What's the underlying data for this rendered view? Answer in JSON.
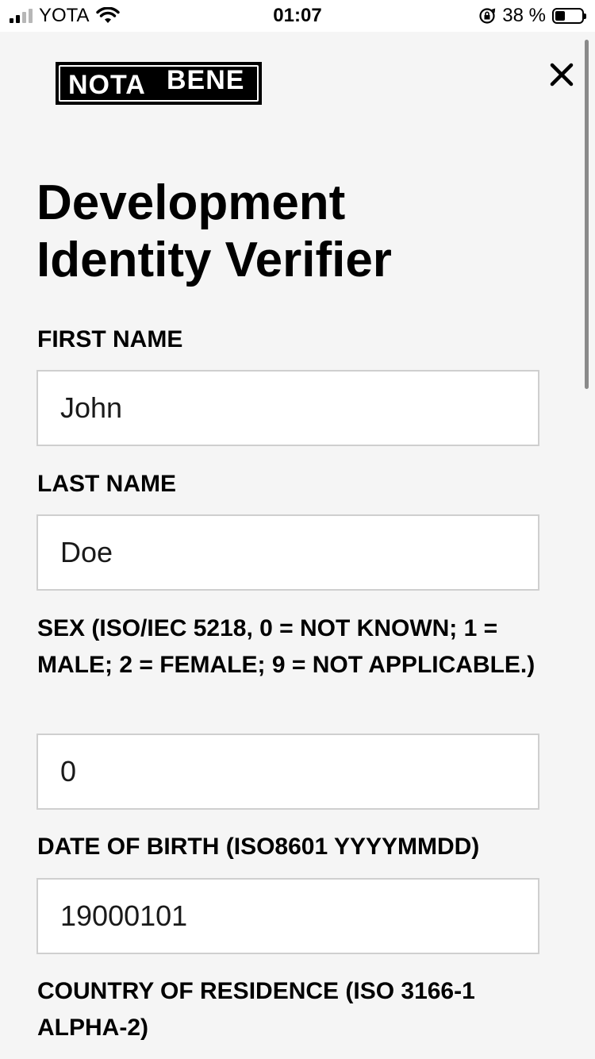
{
  "status_bar": {
    "carrier": "YOTA",
    "time": "01:07",
    "battery_percent": "38 %",
    "battery_level": 0.38,
    "signal_bars": 2
  },
  "header": {
    "logo_left": "NOTA",
    "logo_right": "BENE"
  },
  "form": {
    "title": "Development Identity Verifier",
    "fields": [
      {
        "label": "FIRST NAME",
        "value": "John"
      },
      {
        "label": "LAST NAME",
        "value": "Doe"
      },
      {
        "label": "SEX (ISO/IEC 5218, 0 = NOT KNOWN; 1 = MALE; 2 = FEMALE; 9 = NOT APPLICABLE.)",
        "value": "0"
      },
      {
        "label": "DATE OF BIRTH (ISO8601 YYYYMMDD)",
        "value": "19000101"
      },
      {
        "label": "COUNTRY OF RESIDENCE (ISO 3166-1 ALPHA-2)",
        "value": ""
      }
    ]
  },
  "icons": {
    "close": "close-icon",
    "wifi": "wifi-icon",
    "signal": "signal-icon",
    "rotation_lock": "rotation-lock-icon",
    "battery": "battery-icon"
  },
  "colors": {
    "background": "#f5f5f5",
    "input_border": "#cfcfcf",
    "text": "#000000"
  }
}
